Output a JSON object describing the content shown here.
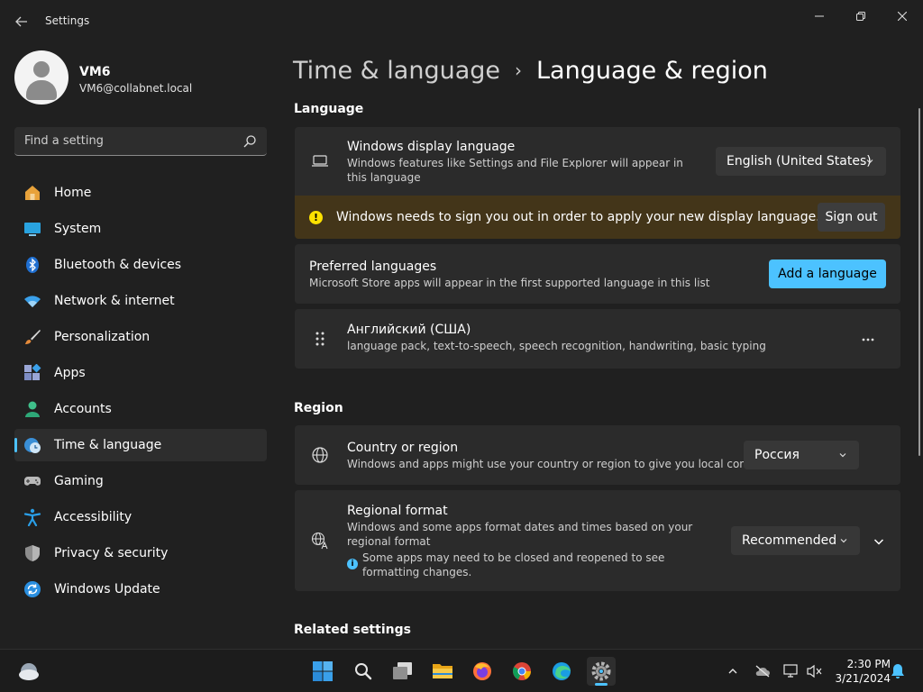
{
  "window": {
    "title": "Settings"
  },
  "user": {
    "name": "VM6",
    "email": "VM6@collabnet.local"
  },
  "search": {
    "placeholder": "Find a setting"
  },
  "nav": [
    {
      "label": "Home",
      "icon": "home-icon"
    },
    {
      "label": "System",
      "icon": "system-icon"
    },
    {
      "label": "Bluetooth & devices",
      "icon": "bluetooth-icon"
    },
    {
      "label": "Network & internet",
      "icon": "wifi-icon"
    },
    {
      "label": "Personalization",
      "icon": "brush-icon"
    },
    {
      "label": "Apps",
      "icon": "apps-icon"
    },
    {
      "label": "Accounts",
      "icon": "accounts-icon"
    },
    {
      "label": "Time & language",
      "icon": "globe-clock-icon",
      "active": true
    },
    {
      "label": "Gaming",
      "icon": "gamepad-icon"
    },
    {
      "label": "Accessibility",
      "icon": "accessibility-icon"
    },
    {
      "label": "Privacy & security",
      "icon": "shield-icon"
    },
    {
      "label": "Windows Update",
      "icon": "update-icon"
    }
  ],
  "breadcrumb": {
    "parent": "Time & language",
    "separator": "›",
    "current": "Language & region"
  },
  "language": {
    "section_title": "Language",
    "display_language": {
      "title": "Windows display language",
      "description": "Windows features like Settings and File Explorer will appear in this language",
      "value": "English (United States)"
    },
    "warning": {
      "text": "Windows needs to sign you out in order to apply your new display language.",
      "button": "Sign out"
    },
    "preferred": {
      "title": "Preferred languages",
      "description": "Microsoft Store apps will appear in the first supported language in this list",
      "button": "Add a language"
    },
    "installed": {
      "title": "Английский (США)",
      "description": "language pack, text-to-speech, speech recognition, handwriting, basic typing"
    }
  },
  "region": {
    "section_title": "Region",
    "country": {
      "title": "Country or region",
      "description": "Windows and apps might use your country or region to give you local content",
      "value": "Россия"
    },
    "format": {
      "title": "Regional format",
      "description": "Windows and some apps format dates and times based on your regional format",
      "note": "Some apps may need to be closed and reopened to see formatting changes.",
      "value": "Recommended"
    }
  },
  "related": {
    "section_title": "Related settings"
  },
  "taskbar": {
    "apps": [
      "start-icon",
      "search-icon",
      "task-view-icon",
      "file-explorer-icon",
      "firefox-icon",
      "chrome-icon",
      "edge-icon",
      "settings-icon"
    ],
    "time": "2:30 PM",
    "date": "3/21/2024"
  },
  "colors": {
    "accent": "#4cc2ff",
    "warning_bg": "#433519",
    "warning_icon": "#fce100"
  }
}
